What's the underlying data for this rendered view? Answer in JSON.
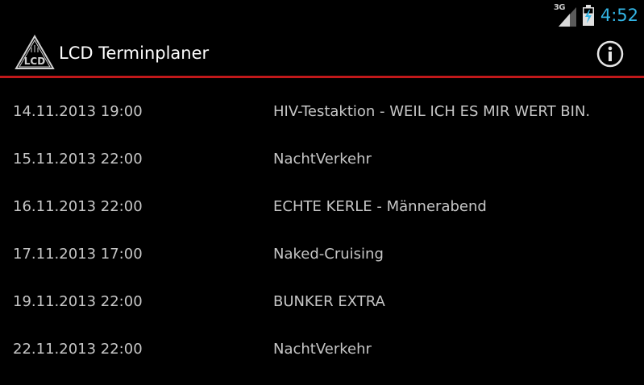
{
  "status_bar": {
    "network_type": "3G",
    "time": "4:52",
    "signal_icon": "signal-strength-icon",
    "battery_icon": "battery-charging-icon",
    "accent_color": "#33b5e5"
  },
  "action_bar": {
    "logo_text": "LCD",
    "title": "LCD Terminplaner",
    "logo_icon": "lcd-triangle-logo-icon",
    "info_icon": "info-icon",
    "divider_color": "#c0181a"
  },
  "events": [
    {
      "date": "14.11.2013 19:00",
      "title": "HIV-Testaktion - WEIL ICH ES MIR WERT BIN."
    },
    {
      "date": "15.11.2013 22:00",
      "title": "NachtVerkehr"
    },
    {
      "date": "16.11.2013 22:00",
      "title": "ECHTE KERLE - Männerabend"
    },
    {
      "date": "17.11.2013 17:00",
      "title": "Naked-Cruising"
    },
    {
      "date": "19.11.2013 22:00",
      "title": "BUNKER EXTRA"
    },
    {
      "date": "22.11.2013 22:00",
      "title": "NachtVerkehr"
    }
  ]
}
